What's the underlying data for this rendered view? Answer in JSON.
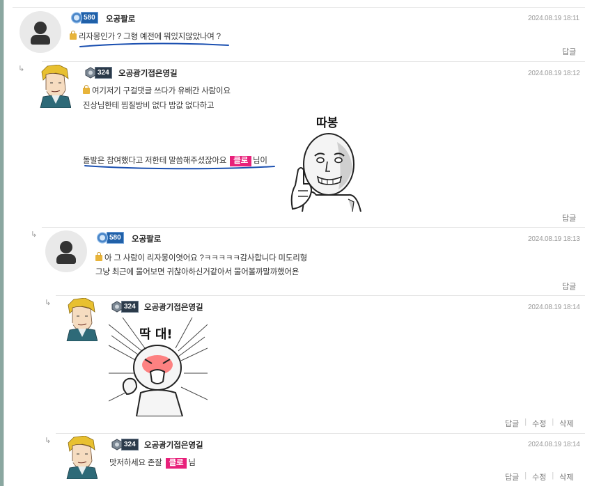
{
  "comments": [
    {
      "nickname": "오공팔로",
      "level": "580",
      "date": "2024.08.19 18:11",
      "lines": [
        "리자몽인가 ? 그형 예전에 뭐있지않았나여 ?"
      ],
      "actions": [
        "답글"
      ]
    },
    {
      "nickname": "오공광기접은영길",
      "level": "324",
      "date": "2024.08.19 18:12",
      "lines": [
        "여기저기 구걸댓글 쓰다가 유배간 사람이요",
        "진상님한테 찜질방비 없다 밥값 없다하고"
      ],
      "line3_pre": "돌발은 참여했다고 저한테 말씀해주셨잖아요",
      "line3_tag": "클로",
      "line3_post": "님이",
      "sticker_text": "따봉",
      "actions": [
        "답글"
      ]
    },
    {
      "nickname": "오공팔로",
      "level": "580",
      "date": "2024.08.19 18:13",
      "lines": [
        "아 그 사람이 리자몽이엿어요 ?ㅋㅋㅋㅋㅋ감사합니다 미도리형",
        "그냥 최근에 물어보면 귀찮아하신거같아서 물어볼까말까했어욘"
      ],
      "actions": [
        "답글"
      ]
    },
    {
      "nickname": "오공광기접은영길",
      "level": "324",
      "date": "2024.08.19 18:14",
      "sticker_text": "딱 대!",
      "actions": [
        "답글",
        "수정",
        "삭제"
      ]
    },
    {
      "nickname": "오공광기접은영길",
      "level": "324",
      "date": "2024.08.19 18:14",
      "line_pre": "맛저하세요 존잘",
      "line_tag": "클로",
      "line_post": "님",
      "actions": [
        "답글",
        "수정",
        "삭제"
      ]
    }
  ],
  "colors": {
    "tag": "#e8207a",
    "underline": "#1a4fb0",
    "separator": "#e4e4e4"
  },
  "icons": [
    "user-avatar-icon",
    "character-avatar-icon",
    "level-badge-icon",
    "lock-icon",
    "reply-arrow-icon"
  ]
}
